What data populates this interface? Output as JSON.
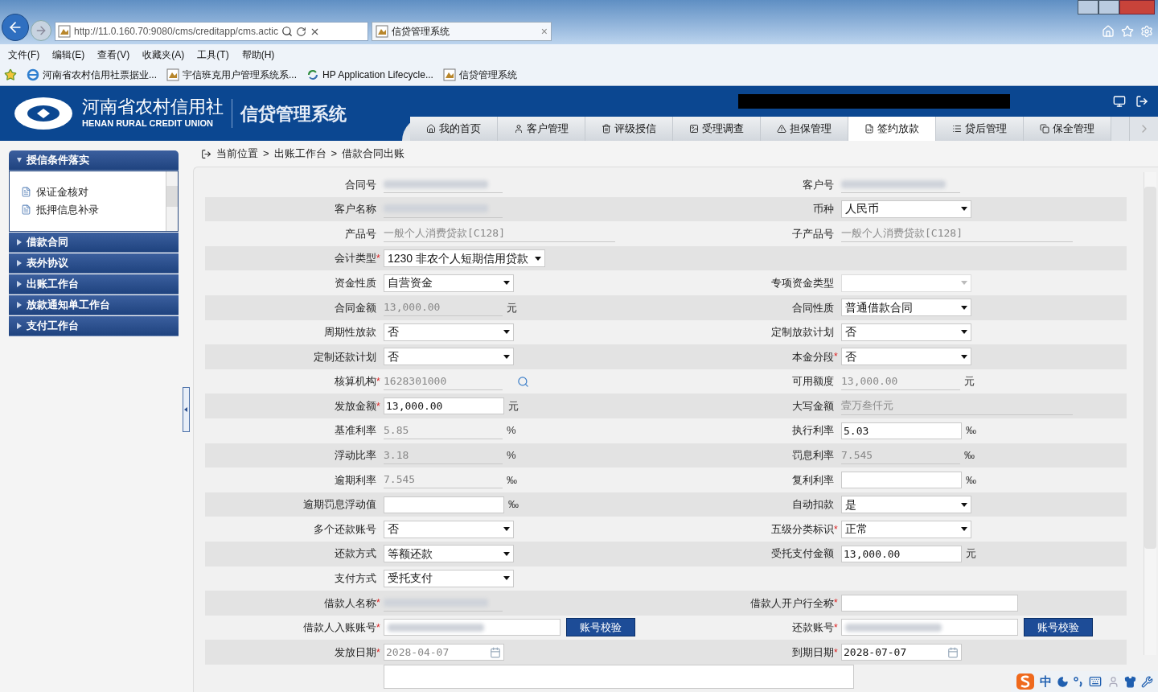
{
  "browser": {
    "address": "http://11.0.160.70:9080/cms/creditapp/cms.actic",
    "tab": {
      "title": "信贷管理系统",
      "close": "×"
    },
    "menu": [
      "文件(F)",
      "编辑(E)",
      "查看(V)",
      "收藏夹(A)",
      "工具(T)",
      "帮助(H)"
    ],
    "favorites": [
      {
        "label": "河南省农村信用社票据业...",
        "kind": "ie"
      },
      {
        "label": "宇信班克用户管理系统系...",
        "kind": "app"
      },
      {
        "label": "HP Application Lifecycle...",
        "kind": "hp"
      },
      {
        "label": "信贷管理系统",
        "kind": "app"
      }
    ]
  },
  "header": {
    "org_name": "河南省农村信用社",
    "org_name_en": "HENAN RURAL CREDIT UNION",
    "system_name": "信贷管理系统",
    "nav": [
      {
        "label": "我的首页",
        "selected": false
      },
      {
        "label": "客户管理",
        "selected": false
      },
      {
        "label": "评级授信",
        "selected": false
      },
      {
        "label": "受理调查",
        "selected": false
      },
      {
        "label": "担保管理",
        "selected": false
      },
      {
        "label": "签约放款",
        "selected": true
      },
      {
        "label": "贷后管理",
        "selected": false
      },
      {
        "label": "保全管理",
        "selected": false
      }
    ]
  },
  "sidebar": [
    {
      "label": "授信条件落实",
      "expanded": true,
      "children": [
        {
          "label": "保证金核对"
        },
        {
          "label": "抵押信息补录"
        }
      ]
    },
    {
      "label": "借款合同",
      "expanded": false
    },
    {
      "label": "表外协议",
      "expanded": false
    },
    {
      "label": "出账工作台",
      "expanded": false
    },
    {
      "label": "放款通知单工作台",
      "expanded": false
    },
    {
      "label": "支付工作台",
      "expanded": false
    }
  ],
  "breadcrumb": {
    "items": [
      "当前位置",
      "出账工作台",
      "借款合同出账"
    ],
    "separator": ">"
  },
  "form": {
    "required_mark": "*",
    "rows": [
      [
        {
          "label": "合同号",
          "required": false,
          "kind": "text",
          "redacted": true
        },
        {
          "label": "客户号",
          "required": false,
          "kind": "text",
          "redacted": true
        }
      ],
      [
        {
          "label": "客户名称",
          "required": false,
          "kind": "text",
          "redacted": true
        },
        {
          "label": "币种",
          "required": false,
          "kind": "select",
          "value": "人民币",
          "disabled": false
        }
      ],
      [
        {
          "label": "产品号",
          "required": false,
          "kind": "longtext",
          "value": "一般个人消费贷款[C128]"
        },
        {
          "label": "子产品号",
          "required": false,
          "kind": "longtext",
          "value": "一般个人消费贷款[C128]"
        }
      ],
      [
        {
          "label": "会计类型",
          "required": true,
          "kind": "select",
          "value": "1230 非农个人短期信用贷款",
          "disabled": false
        },
        null
      ],
      [
        {
          "label": "资金性质",
          "required": false,
          "kind": "select",
          "value": "自营资金",
          "disabled": false
        },
        {
          "label": "专项资金类型",
          "required": false,
          "kind": "select",
          "disabled": true
        }
      ],
      [
        {
          "label": "合同金额",
          "required": false,
          "kind": "text",
          "value": "13,000.00",
          "unit": "元"
        },
        {
          "label": "合同性质",
          "required": false,
          "kind": "select",
          "value": "普通借款合同",
          "disabled": false
        }
      ],
      [
        {
          "label": "周期性放款",
          "required": false,
          "kind": "select",
          "value": "否",
          "disabled": false
        },
        {
          "label": "定制放款计划",
          "required": false,
          "kind": "select",
          "value": "否",
          "disabled": false
        }
      ],
      [
        {
          "label": "定制还款计划",
          "required": false,
          "kind": "select",
          "value": "否",
          "disabled": false
        },
        {
          "label": "本金分段",
          "required": true,
          "kind": "select",
          "value": "否",
          "disabled": false
        }
      ],
      [
        {
          "label": "核算机构",
          "required": true,
          "kind": "lookup",
          "value": "1628301000"
        },
        {
          "label": "可用额度",
          "required": false,
          "kind": "text",
          "value": "13,000.00",
          "unit": "元"
        }
      ],
      [
        {
          "label": "发放金额",
          "required": true,
          "kind": "input",
          "value": "13,000.00",
          "unit": "元",
          "disabled": false
        },
        {
          "label": "大写金额",
          "required": false,
          "kind": "longtext",
          "value": "壹万叁仟元"
        }
      ],
      [
        {
          "label": "基准利率",
          "required": false,
          "kind": "text",
          "value": "5.85",
          "unit": "%"
        },
        {
          "label": "执行利率",
          "required": false,
          "kind": "input",
          "value": "5.03",
          "unit": "‰",
          "disabled": false
        }
      ],
      [
        {
          "label": "浮动比率",
          "required": false,
          "kind": "text",
          "value": "3.18",
          "unit": "%"
        },
        {
          "label": "罚息利率",
          "required": false,
          "kind": "text",
          "value": "7.545",
          "unit": "‰"
        }
      ],
      [
        {
          "label": "逾期利率",
          "required": false,
          "kind": "text",
          "value": "7.545",
          "unit": "‰"
        },
        {
          "label": "复利利率",
          "required": false,
          "kind": "input",
          "unit": "‰",
          "disabled": false
        }
      ],
      [
        {
          "label": "逾期罚息浮动值",
          "required": false,
          "kind": "input",
          "unit": "‰",
          "disabled": false
        },
        {
          "label": "自动扣款",
          "required": false,
          "kind": "select",
          "value": "是",
          "disabled": false
        }
      ],
      [
        {
          "label": "多个还款账号",
          "required": false,
          "kind": "select",
          "value": "否",
          "disabled": false
        },
        {
          "label": "五级分类标识",
          "required": true,
          "kind": "select",
          "value": "正常",
          "disabled": false
        }
      ],
      [
        {
          "label": "还款方式",
          "required": false,
          "kind": "select",
          "value": "等额还款",
          "disabled": false
        },
        {
          "label": "受托支付金额",
          "required": false,
          "kind": "input",
          "value": "13,000.00",
          "unit": "元",
          "disabled": false
        }
      ],
      [
        {
          "label": "支付方式",
          "required": false,
          "kind": "select",
          "value": "受托支付",
          "disabled": false
        },
        null
      ],
      [
        {
          "label": "借款人名称",
          "required": true,
          "kind": "text",
          "redacted": true
        },
        {
          "label": "借款人开户行全称",
          "required": true,
          "kind": "wideinput",
          "disabled": false
        }
      ],
      [
        {
          "label": "借款人入账账号",
          "required": true,
          "kind": "account",
          "redacted": true,
          "button": "账号校验"
        },
        {
          "label": "还款账号",
          "required": true,
          "kind": "account",
          "redacted": true,
          "button": "账号校验"
        }
      ],
      [
        {
          "label": "发放日期",
          "required": true,
          "kind": "date",
          "value": "2028-04-07",
          "disabled": true
        },
        {
          "label": "到期日期",
          "required": true,
          "kind": "date",
          "value": "2028-07-07",
          "disabled": false
        }
      ]
    ]
  },
  "ime": {
    "mode": "中"
  }
}
